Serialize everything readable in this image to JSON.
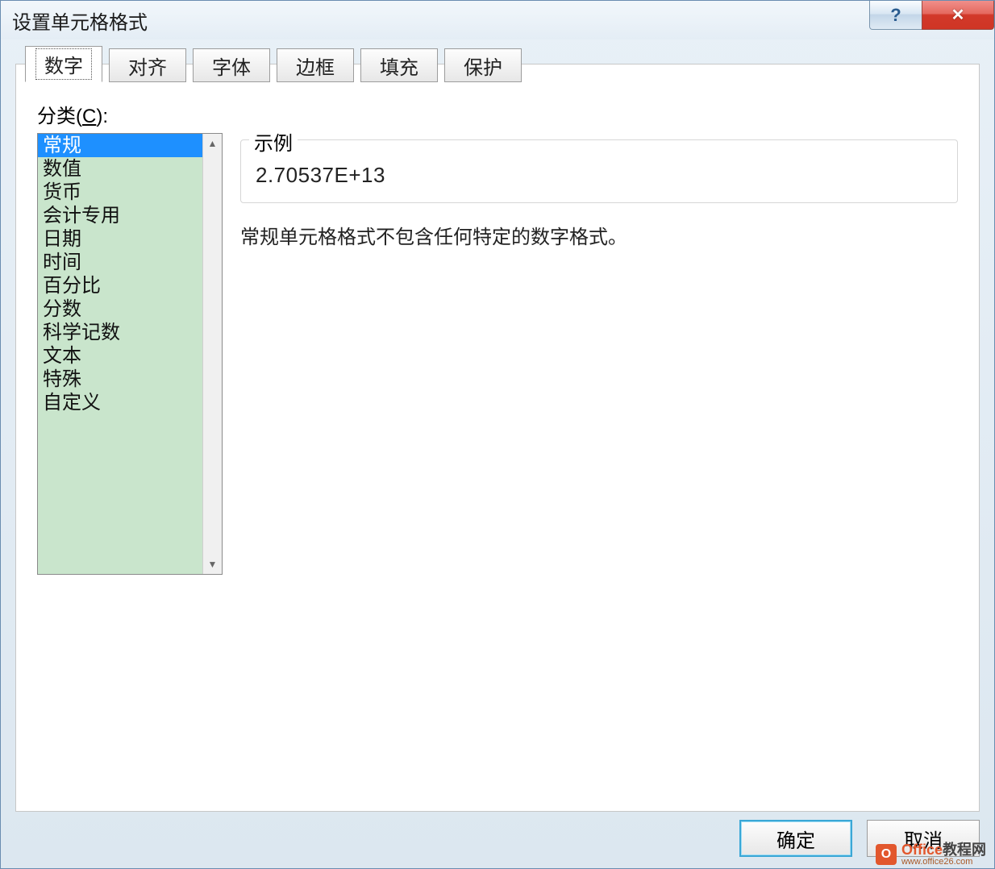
{
  "dialog": {
    "title": "设置单元格格式",
    "tabs": [
      "数字",
      "对齐",
      "字体",
      "边框",
      "填充",
      "保护"
    ],
    "active_tab_index": 0,
    "category_label_prefix": "分类(",
    "category_label_key": "C",
    "category_label_suffix": "):",
    "categories": [
      "常规",
      "数值",
      "货币",
      "会计专用",
      "日期",
      "时间",
      "百分比",
      "分数",
      "科学记数",
      "文本",
      "特殊",
      "自定义"
    ],
    "selected_category_index": 0,
    "sample": {
      "legend": "示例",
      "value": "2.70537E+13"
    },
    "description": "常规单元格格式不包含任何特定的数字格式。",
    "buttons": {
      "ok": "确定",
      "cancel": "取消"
    }
  },
  "watermark": {
    "badge": "O",
    "brand": "Office",
    "suffix": "教程网",
    "url": "www.office26.com"
  }
}
